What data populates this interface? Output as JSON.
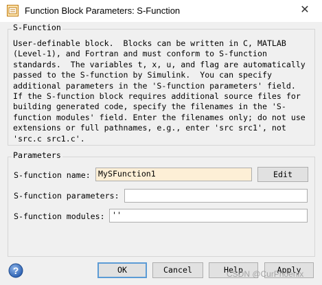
{
  "window": {
    "title": "Function Block Parameters: S-Function",
    "close_glyph": "✕"
  },
  "description_group": {
    "legend": "S-Function",
    "text": "User-definable block.  Blocks can be written in C, MATLAB\n(Level-1), and Fortran and must conform to S-function\nstandards.  The variables t, x, u, and flag are automatically\npassed to the S-function by Simulink.  You can specify\nadditional parameters in the 'S-function parameters' field.\nIf the S-function block requires additional source files for\nbuilding generated code, specify the filenames in the 'S-\nfunction modules' field. Enter the filenames only; do not use\nextensions or full pathnames, e.g., enter 'src src1', not\n'src.c src1.c'."
  },
  "parameters_group": {
    "legend": "Parameters",
    "name_label": "S-function name:",
    "name_value": "MySFunction1",
    "edit_button": "Edit",
    "params_label": "S-function parameters:",
    "params_value": "",
    "modules_label": "S-function modules:",
    "modules_value": "''"
  },
  "buttons": {
    "ok": "OK",
    "cancel": "Cancel",
    "help": "Help",
    "apply": "Apply"
  },
  "watermark": "CSDN @CurPhoenix",
  "icons": {
    "app": "simulink-block-icon",
    "help": "help-question-icon"
  },
  "colors": {
    "name_field_bg": "#fdefd6",
    "ok_border": "#5b9bd5",
    "dialog_bg": "#f0f0f0"
  }
}
